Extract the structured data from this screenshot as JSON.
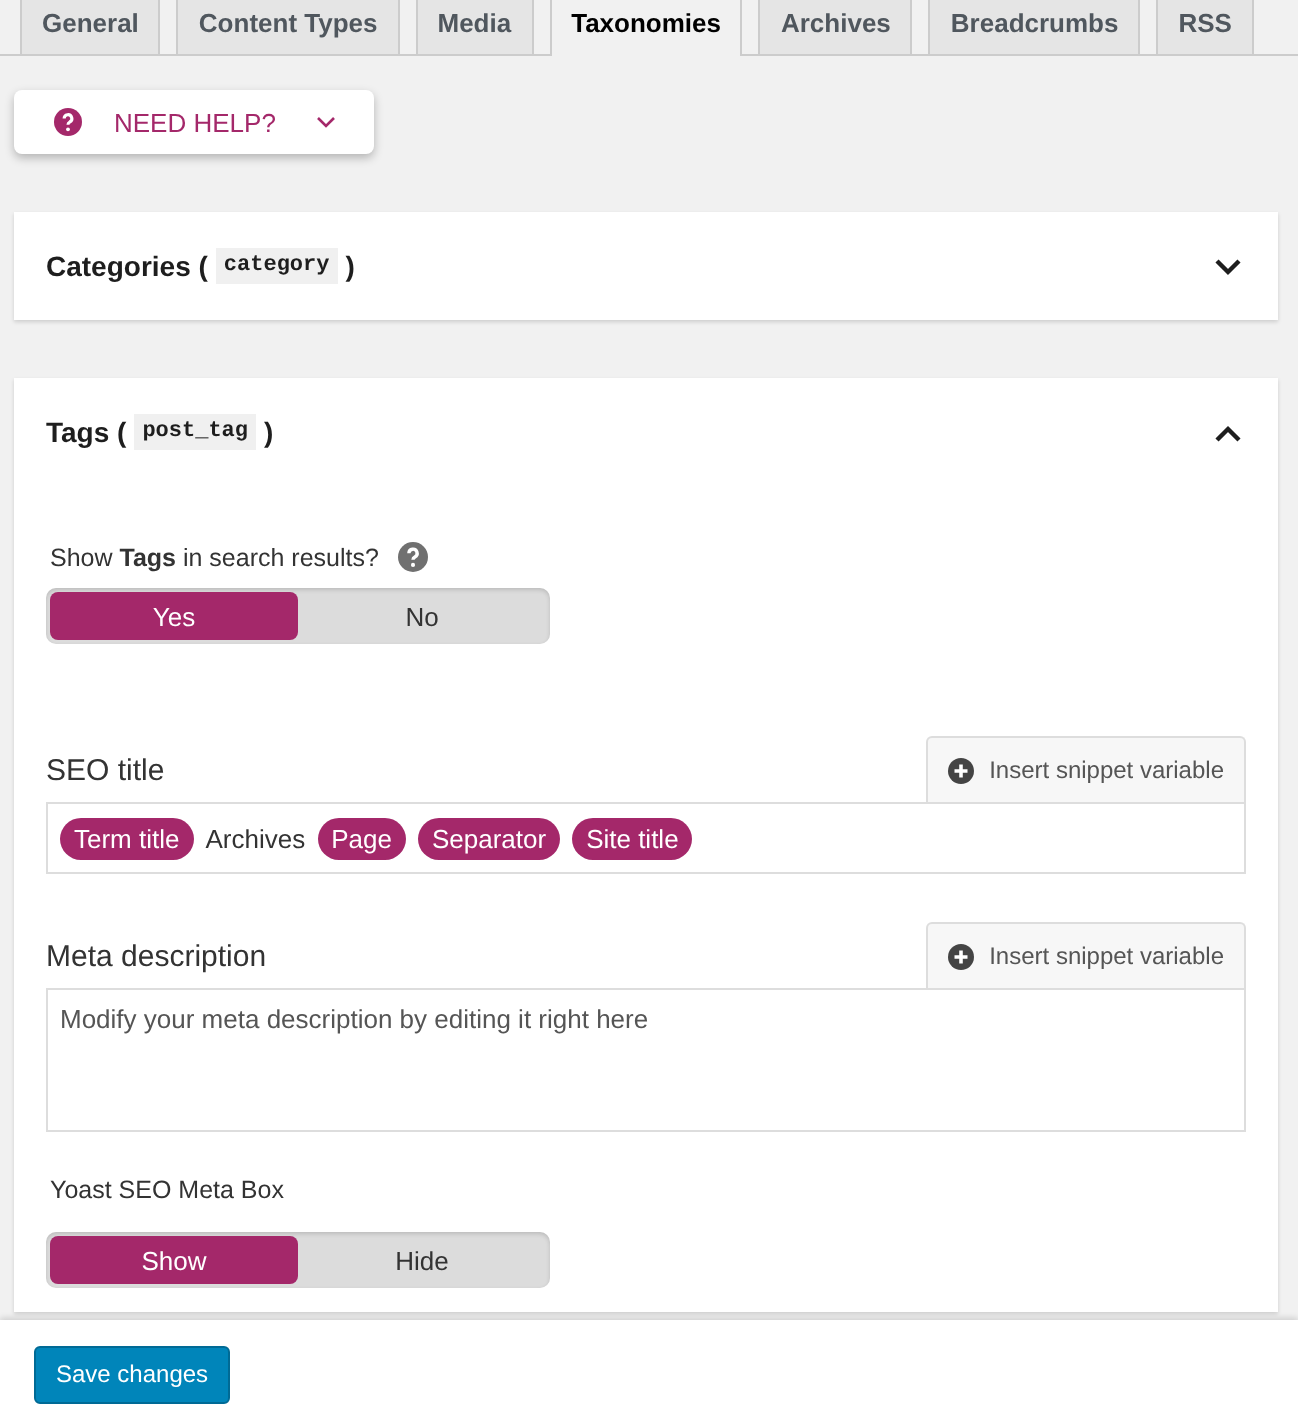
{
  "tabs": [
    {
      "label": "General",
      "selected": false
    },
    {
      "label": "Content Types",
      "selected": false
    },
    {
      "label": "Media",
      "selected": false
    },
    {
      "label": "Taxonomies",
      "selected": true
    },
    {
      "label": "Archives",
      "selected": false
    },
    {
      "label": "Breadcrumbs",
      "selected": false
    },
    {
      "label": "RSS",
      "selected": false
    }
  ],
  "help_button": {
    "label": "NEED HELP?"
  },
  "sections": [
    {
      "title": "Categories (",
      "slug": "category",
      "close": ")",
      "expanded": false
    },
    {
      "title": "Tags (",
      "slug": "post_tag",
      "close": ")",
      "expanded": true,
      "search_toggle": {
        "label": "Show **Tags** in search results?",
        "options": [
          {
            "label": "Yes",
            "selected": true
          },
          {
            "label": "No",
            "selected": false
          }
        ]
      },
      "seo_title": {
        "label": "SEO title",
        "button": "Insert snippet variable",
        "items": [
          {
            "kind": "variable",
            "text": "Term title"
          },
          {
            "kind": "text",
            "text": "Archives"
          },
          {
            "kind": "variable",
            "text": "Page"
          },
          {
            "kind": "variable",
            "text": "Separator"
          },
          {
            "kind": "variable",
            "text": "Site title"
          }
        ]
      },
      "meta_description": {
        "label": "Meta description",
        "button": "Insert snippet variable",
        "placeholder": "Modify your meta description by editing it right here"
      },
      "meta_box_toggle": {
        "label": "Yoast SEO Meta Box",
        "options": [
          {
            "label": "Show",
            "selected": true
          },
          {
            "label": "Hide",
            "selected": false
          }
        ]
      }
    }
  ],
  "save_button": "Save changes"
}
